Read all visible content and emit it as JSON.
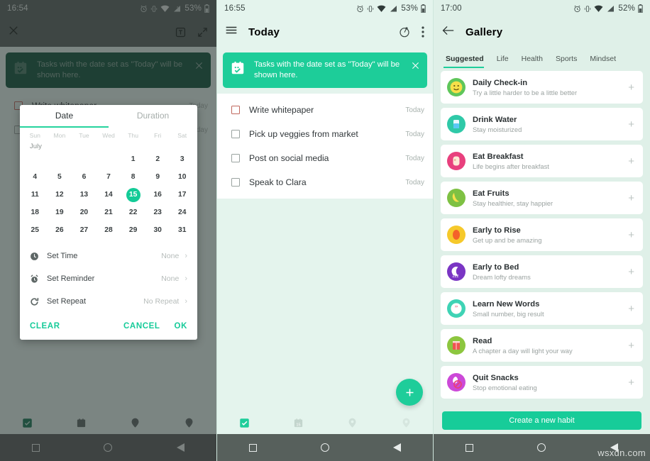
{
  "panels": {
    "left": {
      "status": {
        "time": "16:54",
        "battery": "53%"
      },
      "appbar": {
        "close_icon": "close-icon",
        "text_format_icon": "text-format-icon",
        "expand_icon": "expand-icon"
      },
      "banner": {
        "text": "Tasks with the date set as \"Today\" will be shown here.",
        "icon": "calendar-check-icon",
        "close": "×"
      },
      "tasks": [
        {
          "label": "Write whitepaper",
          "when": "Today"
        },
        {
          "label": "Pick up veggies from market",
          "when": "Today"
        }
      ],
      "dialog": {
        "tabs": [
          {
            "label": "Date",
            "active": true
          },
          {
            "label": "Duration",
            "active": false
          }
        ],
        "month": "July",
        "weekdays": [
          "Sun",
          "Mon",
          "Tue",
          "Wed",
          "Thu",
          "Fri",
          "Sat"
        ],
        "weeks": [
          [
            "",
            "",
            "",
            "",
            "1",
            "2",
            "3"
          ],
          [
            "4",
            "5",
            "6",
            "7",
            "8",
            "9",
            "10"
          ],
          [
            "11",
            "12",
            "13",
            "14",
            "15",
            "16",
            "17"
          ],
          [
            "18",
            "19",
            "20",
            "21",
            "22",
            "23",
            "24"
          ],
          [
            "25",
            "26",
            "27",
            "28",
            "29",
            "30",
            "31"
          ]
        ],
        "selected_day": "15",
        "options": [
          {
            "icon": "clock-icon",
            "label": "Set Time",
            "value": "None"
          },
          {
            "icon": "alarm-icon",
            "label": "Set Reminder",
            "value": "None"
          },
          {
            "icon": "repeat-icon",
            "label": "Set Repeat",
            "value": "No Repeat"
          }
        ],
        "buttons": {
          "clear": "CLEAR",
          "cancel": "CANCEL",
          "ok": "OK"
        }
      }
    },
    "mid": {
      "status": {
        "time": "16:55",
        "battery": "53%"
      },
      "appbar": {
        "menu_icon": "hamburger-menu-icon",
        "title": "Today",
        "timer_icon": "pomodoro-timer-icon",
        "overflow_icon": "overflow-menu-icon"
      },
      "banner": {
        "text": "Tasks with the date set as \"Today\" will be shown here.",
        "icon": "calendar-check-icon",
        "close": "×"
      },
      "tasks": [
        {
          "label": "Write whitepaper",
          "when": "Today"
        },
        {
          "label": "Pick up veggies from market",
          "when": "Today"
        },
        {
          "label": "Post on social media",
          "when": "Today"
        },
        {
          "label": "Speak to Clara",
          "when": "Today"
        }
      ],
      "fab": {
        "label": "+",
        "name": "add-task-fab"
      }
    },
    "right": {
      "status": {
        "time": "17:00",
        "battery": "52%"
      },
      "appbar": {
        "back_icon": "back-arrow-icon",
        "title": "Gallery"
      },
      "tabs": [
        {
          "label": "Suggested",
          "active": true
        },
        {
          "label": "Life",
          "active": false
        },
        {
          "label": "Health",
          "active": false
        },
        {
          "label": "Sports",
          "active": false
        },
        {
          "label": "Mindset",
          "active": false
        }
      ],
      "habits": [
        {
          "name": "Daily Check-in",
          "desc": "Try a little harder to be a little better",
          "icon": "smiley-face-icon",
          "color": "#5fc65a",
          "add": "+"
        },
        {
          "name": "Drink Water",
          "desc": "Stay moisturized",
          "icon": "water-glass-icon",
          "color": "#2fc9a8",
          "add": "+"
        },
        {
          "name": "Eat Breakfast",
          "desc": "Life begins after breakfast",
          "icon": "bread-icon",
          "color": "#e8407d",
          "add": "+"
        },
        {
          "name": "Eat Fruits",
          "desc": "Stay healthier, stay happier",
          "icon": "banana-icon",
          "color": "#7ec143",
          "add": "+"
        },
        {
          "name": "Early to Rise",
          "desc": "Get up and be amazing",
          "icon": "sunrise-icon",
          "color": "#f6c92b",
          "add": "+"
        },
        {
          "name": "Early to Bed",
          "desc": "Dream lofty dreams",
          "icon": "moon-sleep-icon",
          "color": "#7a35c4",
          "add": "+"
        },
        {
          "name": "Learn New Words",
          "desc": "Small number, big result",
          "icon": "quote-icon",
          "color": "#3fd3b5",
          "add": "+"
        },
        {
          "name": "Read",
          "desc": "A chapter a day will light your way",
          "icon": "book-icon",
          "color": "#8dc63f",
          "add": "+"
        },
        {
          "name": "Quit Snacks",
          "desc": "Stop emotional eating",
          "icon": "no-snacks-icon",
          "color": "#cc49d8",
          "add": "+"
        }
      ],
      "create_button": "Create a new habit"
    }
  },
  "bottom_nav": {
    "items": [
      {
        "name": "tasks-tab",
        "icon": "checkbox-icon",
        "active": true
      },
      {
        "name": "calendar-tab",
        "icon": "calendar-15-icon",
        "active": false
      },
      {
        "name": "places-tab",
        "icon": "location-pin-icon",
        "active": false
      },
      {
        "name": "habits-tab",
        "icon": "target-icon",
        "active": false
      }
    ]
  },
  "system_nav": {
    "recents": "square",
    "home": "circle",
    "back": "triangle"
  },
  "watermark": "wsxdn.com",
  "colors": {
    "accent": "#1ece9a",
    "banner_green": "#1dcd99",
    "banner_dim_green": "#12533f",
    "panel_bg": "#e1f2ea"
  }
}
